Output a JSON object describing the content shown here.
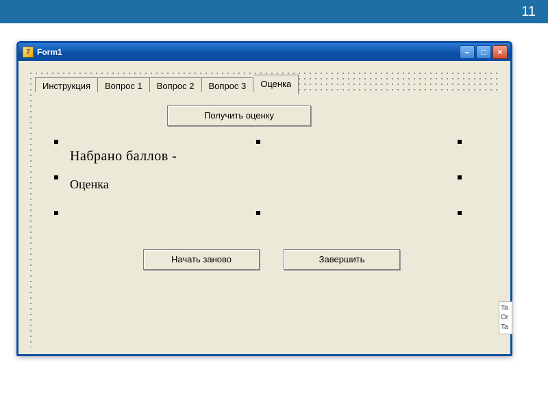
{
  "slide": {
    "number": "11"
  },
  "window": {
    "icon_glyph": "7",
    "title": "Form1",
    "min_symbol": "–",
    "max_symbol": "□",
    "close_symbol": "×"
  },
  "tabs": {
    "items": [
      {
        "label": "Инструкция",
        "active": false
      },
      {
        "label": "Вопрос 1",
        "active": false
      },
      {
        "label": "Вопрос 2",
        "active": false
      },
      {
        "label": "Вопрос 3",
        "active": false
      },
      {
        "label": "Оценка",
        "active": true
      }
    ]
  },
  "page": {
    "get_grade_button": "Получить оценку",
    "score_label": "Набрано баллов  -",
    "grade_label": "Оценка",
    "restart_button": "Начать заново",
    "finish_button": "Завершить"
  },
  "prop_peek": {
    "line1": "Ta",
    "line2": "Or",
    "line3": "Ta"
  }
}
